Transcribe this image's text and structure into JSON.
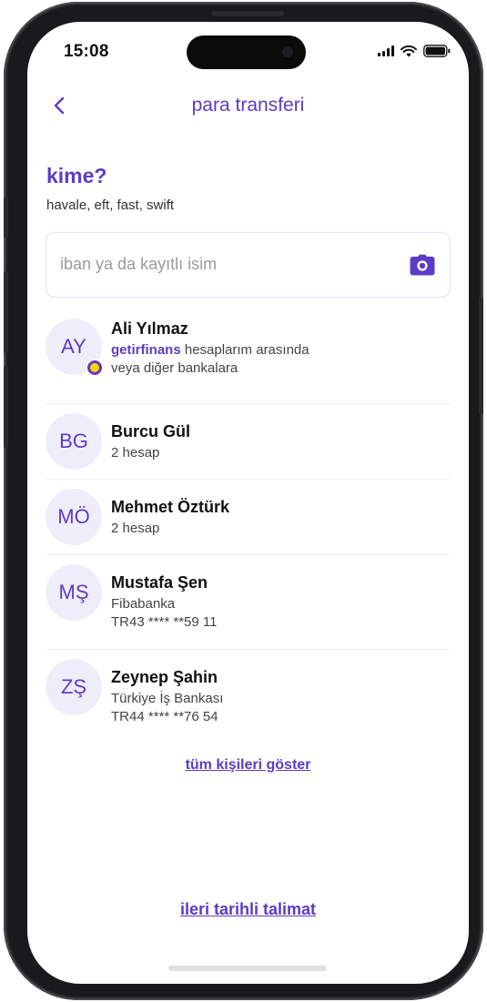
{
  "status_bar": {
    "time": "15:08"
  },
  "header": {
    "title": "para transferi"
  },
  "section": {
    "heading": "kime?",
    "subheading": "havale, eft, fast, swift"
  },
  "search": {
    "placeholder": "iban ya da kayıtlı isim"
  },
  "contacts": [
    {
      "initials": "AY",
      "name": "Ali Yılmaz",
      "brand": "getirfinans",
      "line1_rest": " hesaplarım arasında",
      "line2": "veya diğer bankalara"
    },
    {
      "initials": "BG",
      "name": "Burcu Gül",
      "line1": "2 hesap"
    },
    {
      "initials": "MÖ",
      "name": "Mehmet Öztürk",
      "line1": "2 hesap"
    },
    {
      "initials": "MŞ",
      "name": "Mustafa Şen",
      "line1": "Fibabanka",
      "line2": "TR43 **** **59 11"
    },
    {
      "initials": "ZŞ",
      "name": "Zeynep Şahin",
      "line1": "Türkiye İş Bankası",
      "line2": "TR44 **** **76 54"
    }
  ],
  "links": {
    "show_all": "tüm kişileri göster",
    "future_order": "ileri tarihli talimat"
  },
  "colors": {
    "accent": "#5b3cc4",
    "avatar_bg": "#f0edfa",
    "badge_dot": "#ffd300"
  },
  "icons": [
    "back-chevron-icon",
    "camera-icon",
    "getir-badge-icon",
    "signal-icon",
    "wifi-icon",
    "battery-icon"
  ]
}
